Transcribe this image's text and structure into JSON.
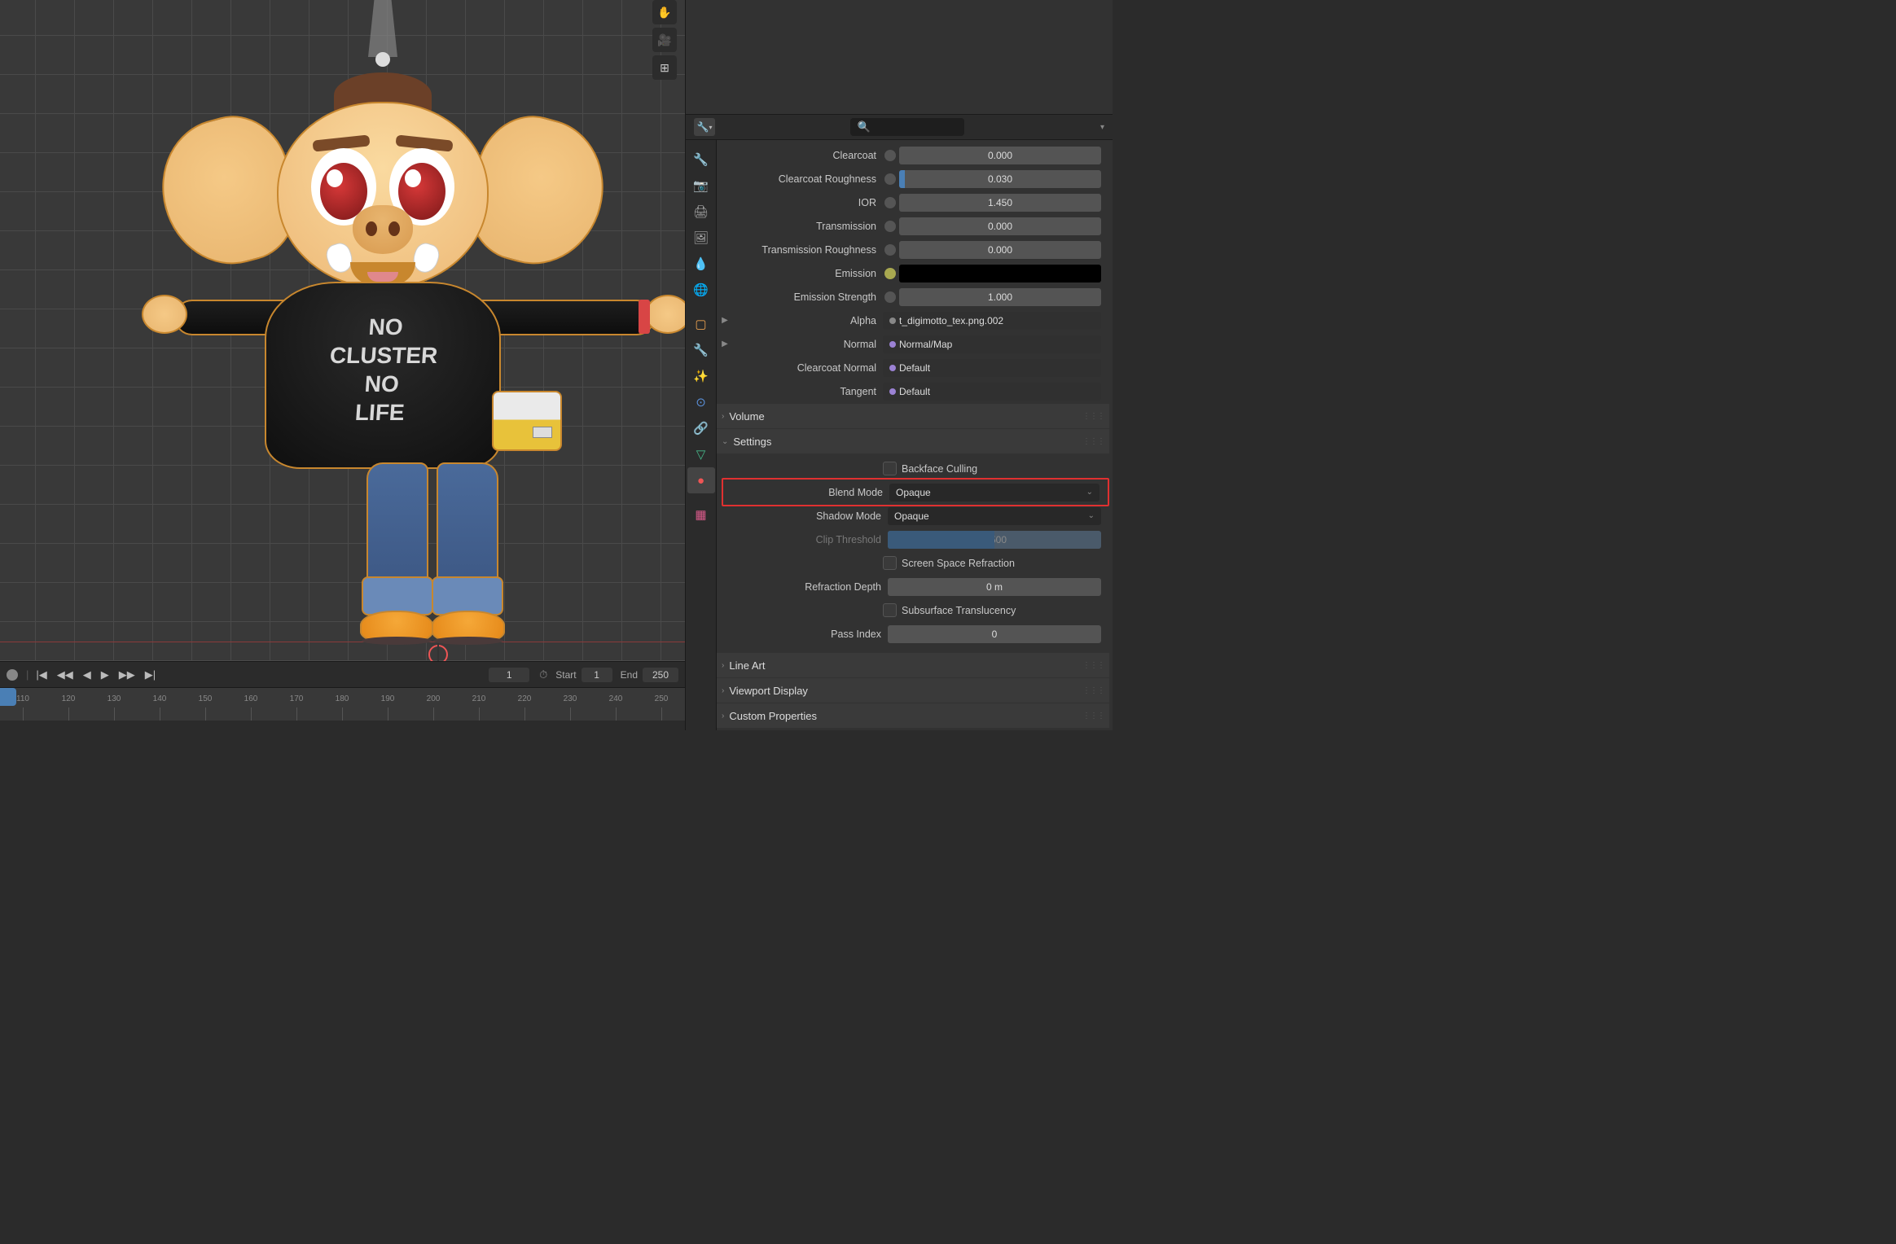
{
  "viewport": {
    "overlay_icons": [
      "hand",
      "camera",
      "grid"
    ],
    "shirt_lines": [
      "NO",
      "CLUSTER",
      "NO",
      "LIFE"
    ]
  },
  "timeline": {
    "current": "1",
    "start_label": "Start",
    "start": "1",
    "end_label": "End",
    "end": "250",
    "ticks": [
      "110",
      "120",
      "130",
      "140",
      "150",
      "160",
      "170",
      "180",
      "190",
      "200",
      "210",
      "220",
      "230",
      "240",
      "250"
    ]
  },
  "search": {
    "placeholder": ""
  },
  "material": {
    "params": {
      "clearcoat": {
        "label": "Clearcoat",
        "value": "0.000",
        "fill": 0
      },
      "clearcoat_roughness": {
        "label": "Clearcoat Roughness",
        "value": "0.030",
        "fill": 3
      },
      "ior": {
        "label": "IOR",
        "value": "1.450",
        "fill": 0
      },
      "transmission": {
        "label": "Transmission",
        "value": "0.000",
        "fill": 0
      },
      "transmission_roughness": {
        "label": "Transmission Roughness",
        "value": "0.000",
        "fill": 0
      },
      "emission": {
        "label": "Emission"
      },
      "emission_strength": {
        "label": "Emission Strength",
        "value": "1.000",
        "fill": 0
      },
      "alpha": {
        "label": "Alpha",
        "value": "t_digimotto_tex.png.002"
      },
      "normal": {
        "label": "Normal",
        "value": "Normal/Map"
      },
      "clearcoat_normal": {
        "label": "Clearcoat Normal",
        "value": "Default"
      },
      "tangent": {
        "label": "Tangent",
        "value": "Default"
      }
    },
    "panels": {
      "volume": "Volume",
      "settings": "Settings",
      "line_art": "Line Art",
      "viewport_display": "Viewport Display",
      "custom_properties": "Custom Properties"
    },
    "settings": {
      "backface_culling": "Backface Culling",
      "blend_mode": {
        "label": "Blend Mode",
        "value": "Opaque"
      },
      "shadow_mode": {
        "label": "Shadow Mode",
        "value": "Opaque"
      },
      "clip_threshold": {
        "label": "Clip Threshold",
        "value": "0.500"
      },
      "screen_space_refraction": "Screen Space Refraction",
      "refraction_depth": {
        "label": "Refraction Depth",
        "value": "0 m"
      },
      "subsurface_translucency": "Subsurface Translucency",
      "pass_index": {
        "label": "Pass Index",
        "value": "0"
      }
    }
  }
}
